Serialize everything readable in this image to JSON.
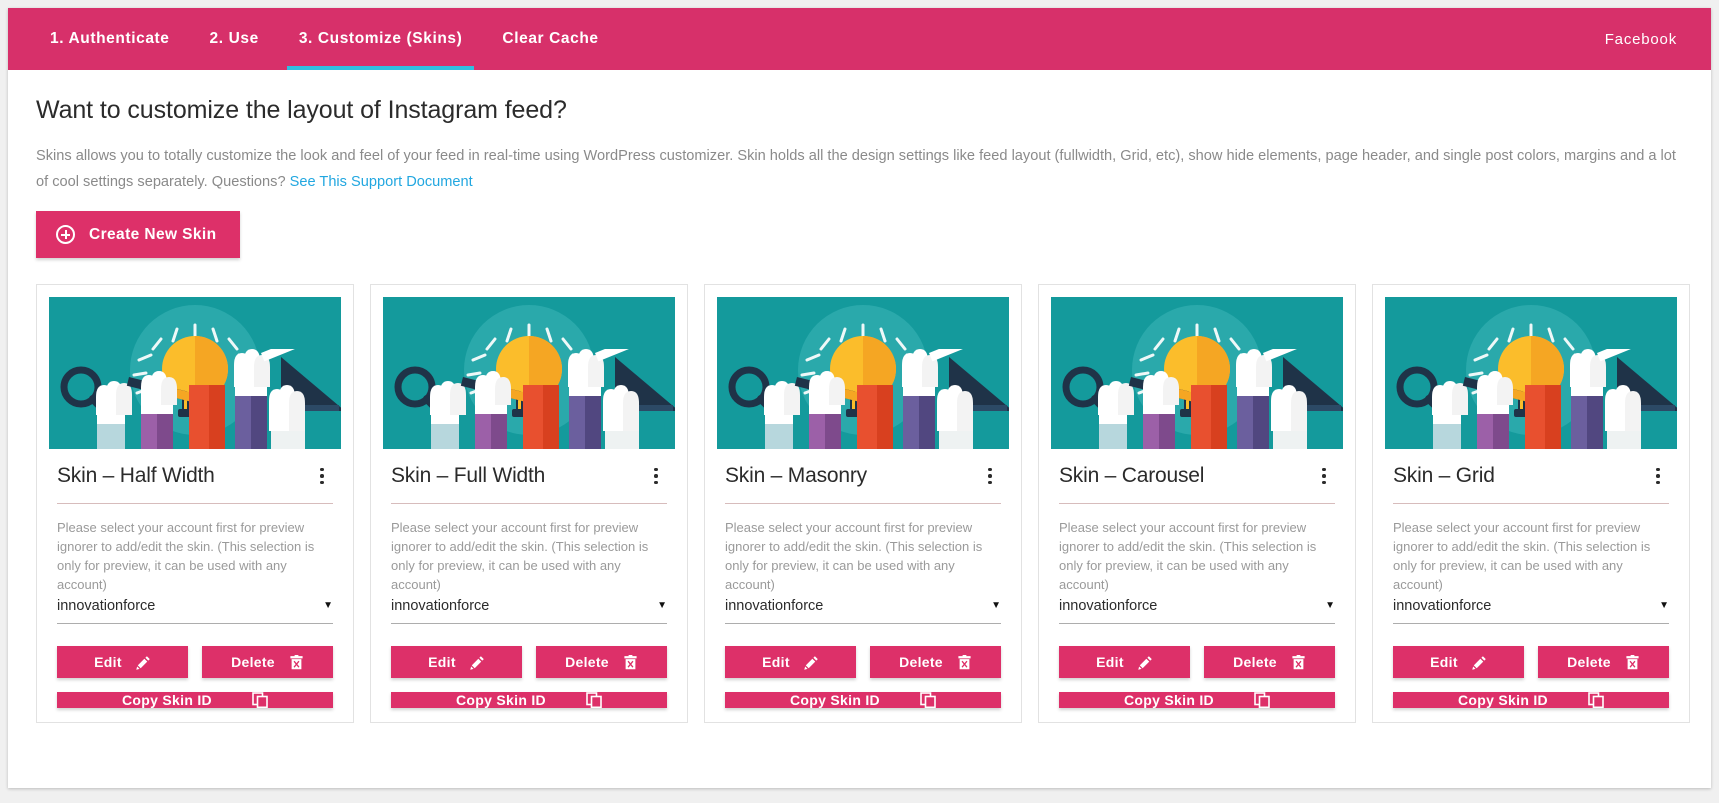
{
  "topbar": {
    "tabs": [
      {
        "label": "1. Authenticate",
        "active": false
      },
      {
        "label": "2. Use",
        "active": false
      },
      {
        "label": "3. Customize (Skins)",
        "active": true
      },
      {
        "label": "Clear Cache",
        "active": false
      }
    ],
    "right_link": "Facebook",
    "bg_color": "#d7306a",
    "active_underline_color": "#2fbfe0"
  },
  "main": {
    "title": "Want to customize the layout of Instagram feed?",
    "description_part1": "Skins allows you to totally customize the look and feel of your feed in real-time using WordPress customizer. Skin holds all the design settings like feed layout (fullwidth, Grid, etc), show hide elements, page header, and single post colors, margins and a lot of cool settings separately. Questions? ",
    "description_link": "See This Support Document",
    "create_button": "Create New Skin",
    "accent_color": "#dd3069",
    "link_color": "#22a7e0"
  },
  "card_common": {
    "description": "Please select your account first for preview ignorer to add/edit the skin. (This selection is only for preview, it can be used with any account)",
    "select_value": "innovationforce",
    "select_caret": "▼",
    "edit_label": "Edit",
    "delete_label": "Delete",
    "copy_label": "Copy Skin ID"
  },
  "cards": [
    {
      "title": "Skin – Half Width"
    },
    {
      "title": "Skin – Full Width"
    },
    {
      "title": "Skin – Masonry"
    },
    {
      "title": "Skin – Carousel"
    },
    {
      "title": "Skin – Grid"
    }
  ]
}
